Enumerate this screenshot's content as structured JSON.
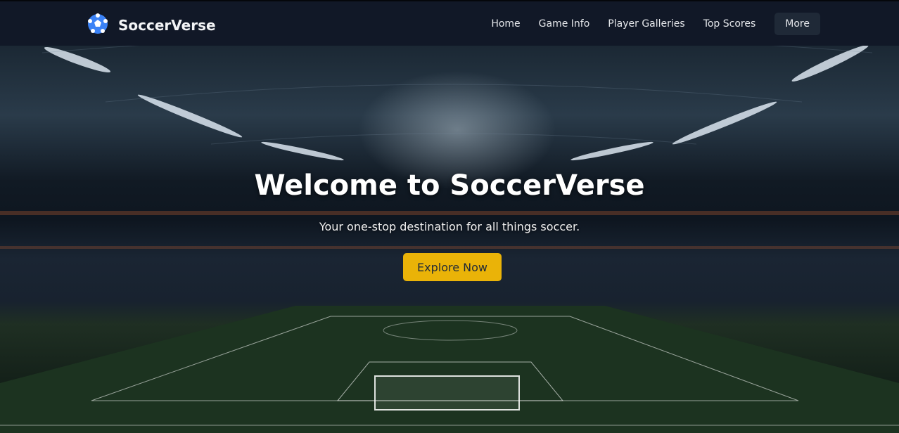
{
  "brand": {
    "name": "SoccerVerse",
    "icon": "soccer-ball-icon"
  },
  "nav": {
    "items": [
      {
        "label": "Home"
      },
      {
        "label": "Game Info"
      },
      {
        "label": "Player Galleries"
      },
      {
        "label": "Top Scores"
      },
      {
        "label": "More"
      }
    ]
  },
  "hero": {
    "title": "Welcome to SoccerVerse",
    "subtitle": "Your one-stop destination for all things soccer.",
    "cta": "Explore Now"
  },
  "colors": {
    "nav_bg": "#111827",
    "more_bg": "#1f2937",
    "cta": "#eab308"
  }
}
